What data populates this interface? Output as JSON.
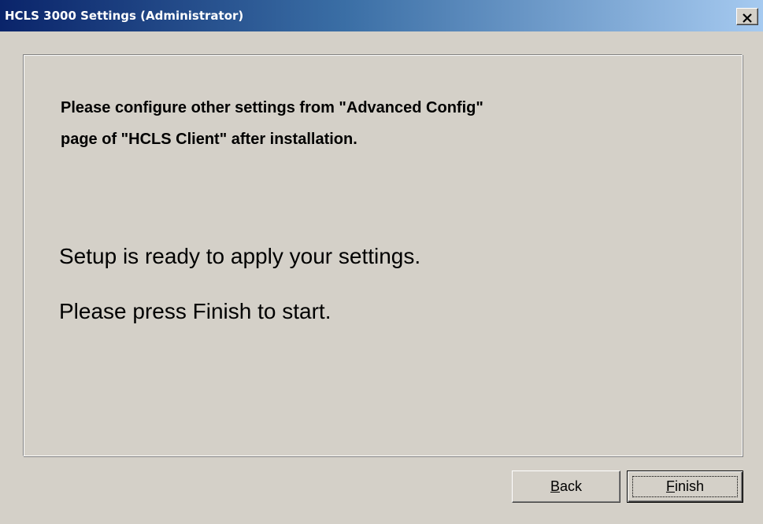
{
  "window": {
    "title": "HCLS 3000 Settings (Administrator)"
  },
  "icons": {
    "close": "close-icon"
  },
  "content": {
    "info_line1": "Please configure other settings from \"Advanced Config\"",
    "info_line2": "page of \"HCLS Client\" after installation.",
    "ready_message": "Setup is ready to apply your settings.",
    "press_message": "Please press Finish to start."
  },
  "buttons": {
    "back_mnemonic": "B",
    "back_rest": "ack",
    "finish_mnemonic": "F",
    "finish_rest": "inish"
  },
  "colors": {
    "titlebar_start": "#0a246a",
    "titlebar_end": "#a6caf0",
    "face": "#d4d0c8"
  }
}
